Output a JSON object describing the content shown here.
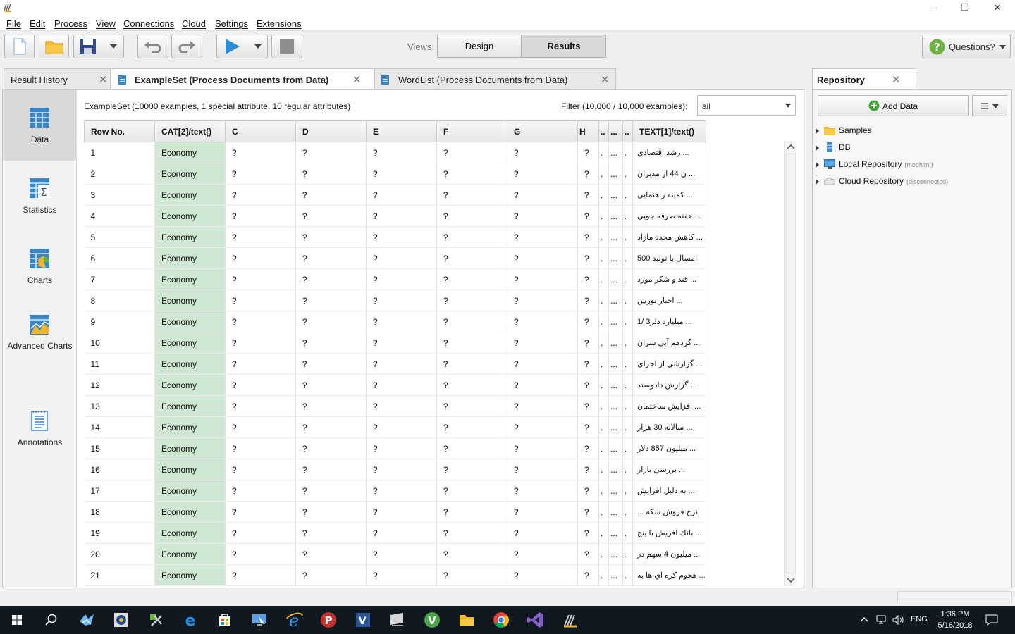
{
  "window": {
    "minimize": "–",
    "maximize": "❐",
    "close": "✕"
  },
  "menu": [
    "File",
    "Edit",
    "Process",
    "View",
    "Connections",
    "Cloud",
    "Settings",
    "Extensions"
  ],
  "toolbar": {
    "views_label": "Views:",
    "design_label": "Design",
    "results_label": "Results",
    "questions_label": "Questions?"
  },
  "tabs": [
    {
      "label": "Result History"
    },
    {
      "label": "ExampleSet (Process Documents from Data)"
    },
    {
      "label": "WordList (Process Documents from Data)"
    }
  ],
  "sidebar": [
    {
      "label": "Data"
    },
    {
      "label": "Statistics"
    },
    {
      "label": "Charts"
    },
    {
      "label": "Advanced Charts"
    },
    {
      "label": "Annotations"
    }
  ],
  "info": {
    "summary": "ExampleSet (10000 examples, 1 special attribute, 10 regular attributes)",
    "filter_label": "Filter (10,000 / 10,000 examples):",
    "filter_value": "all"
  },
  "table": {
    "columns": [
      "Row No.",
      "CAT[2]/text()",
      "C",
      "D",
      "E",
      "F",
      "G",
      "H",
      "..",
      "...",
      "..",
      "TEXT[1]/text()"
    ],
    "rows": [
      [
        "1",
        "Economy",
        "?",
        "?",
        "?",
        "?",
        "?",
        "?",
        ".",
        "...",
        ".",
        "رشد اقتصادي ..."
      ],
      [
        "2",
        "Economy",
        "?",
        "?",
        "?",
        "?",
        "?",
        "?",
        ".",
        "...",
        ".",
        "ن 44 از مديران ..."
      ],
      [
        "3",
        "Economy",
        "?",
        "?",
        "?",
        "?",
        "?",
        "?",
        ".",
        "...",
        ".",
        "كميته راهنمايي ..."
      ],
      [
        "4",
        "Economy",
        "?",
        "?",
        "?",
        "?",
        "?",
        "?",
        ".",
        "...",
        ".",
        "هفته صرفه جويي ..."
      ],
      [
        "5",
        "Economy",
        "?",
        "?",
        "?",
        "?",
        "?",
        "?",
        ".",
        "...",
        ".",
        "كاهش مجدد مازاد ..."
      ],
      [
        "6",
        "Economy",
        "?",
        "?",
        "?",
        "?",
        "?",
        "?",
        ".",
        "...",
        ".",
        "امسال با توليد 500"
      ],
      [
        "7",
        "Economy",
        "?",
        "?",
        "?",
        "?",
        "?",
        "?",
        ".",
        "...",
        ".",
        "قند و شكر مورد ..."
      ],
      [
        "8",
        "Economy",
        "?",
        "?",
        "?",
        "?",
        "?",
        "?",
        ".",
        "...",
        ".",
        "اخبار بورس ..."
      ],
      [
        "9",
        "Economy",
        "?",
        "?",
        "?",
        "?",
        "?",
        "?",
        ".",
        "...",
        ".",
        "1/ 3ميليارد دلر ..."
      ],
      [
        "10",
        "Economy",
        "?",
        "?",
        "?",
        "?",
        "?",
        "?",
        ".",
        "...",
        ".",
        "گردهم آيي سران ..."
      ],
      [
        "11",
        "Economy",
        "?",
        "?",
        "?",
        "?",
        "?",
        "?",
        ".",
        "...",
        ".",
        "گزارشي از اجراي ..."
      ],
      [
        "12",
        "Economy",
        "?",
        "?",
        "?",
        "?",
        "?",
        "?",
        ".",
        "...",
        ".",
        "گزارش دادوستد ..."
      ],
      [
        "13",
        "Economy",
        "?",
        "?",
        "?",
        "?",
        "?",
        "?",
        ".",
        "...",
        ".",
        "افزايش ساختمان ..."
      ],
      [
        "14",
        "Economy",
        "?",
        "?",
        "?",
        "?",
        "?",
        "?",
        ".",
        "...",
        ".",
        "سالانه 30 هزار ..."
      ],
      [
        "15",
        "Economy",
        "?",
        "?",
        "?",
        "?",
        "?",
        "?",
        ".",
        "...",
        ".",
        "ميليون 857 دلار ..."
      ],
      [
        "16",
        "Economy",
        "?",
        "?",
        "?",
        "?",
        "?",
        "?",
        ".",
        "...",
        ".",
        "بررسي بازار ..."
      ],
      [
        "17",
        "Economy",
        "?",
        "?",
        "?",
        "?",
        "?",
        "?",
        ".",
        "...",
        ".",
        "به دليل افزايش ..."
      ],
      [
        "18",
        "Economy",
        "?",
        "?",
        "?",
        "?",
        "?",
        "?",
        ".",
        "...",
        ".",
        "... نرخ فروش سكه"
      ],
      [
        "19",
        "Economy",
        "?",
        "?",
        "?",
        "?",
        "?",
        "?",
        ".",
        "...",
        ".",
        "بانك افريش با پنج ..."
      ],
      [
        "20",
        "Economy",
        "?",
        "?",
        "?",
        "?",
        "?",
        "?",
        ".",
        "...",
        ".",
        "ميليون 4 سهم در ..."
      ],
      [
        "21",
        "Economy",
        "?",
        "?",
        "?",
        "?",
        "?",
        "?",
        ".",
        "...",
        ".",
        "هجوم كره اي ها به ..."
      ]
    ]
  },
  "repository": {
    "title": "Repository",
    "add_data": "Add Data",
    "items": [
      {
        "label": "Samples",
        "sub": ""
      },
      {
        "label": "DB",
        "sub": ""
      },
      {
        "label": "Local Repository",
        "sub": "(moghimi)"
      },
      {
        "label": "Cloud Repository",
        "sub": "(disconnected)"
      }
    ]
  },
  "taskbar": {
    "time": "1:36 PM",
    "date": "5/16/2018",
    "lang": "ENG"
  },
  "colors": {
    "category_cell": "#cfe7d3",
    "accent_play": "#2a8fd8",
    "taskbar": "#101820"
  }
}
